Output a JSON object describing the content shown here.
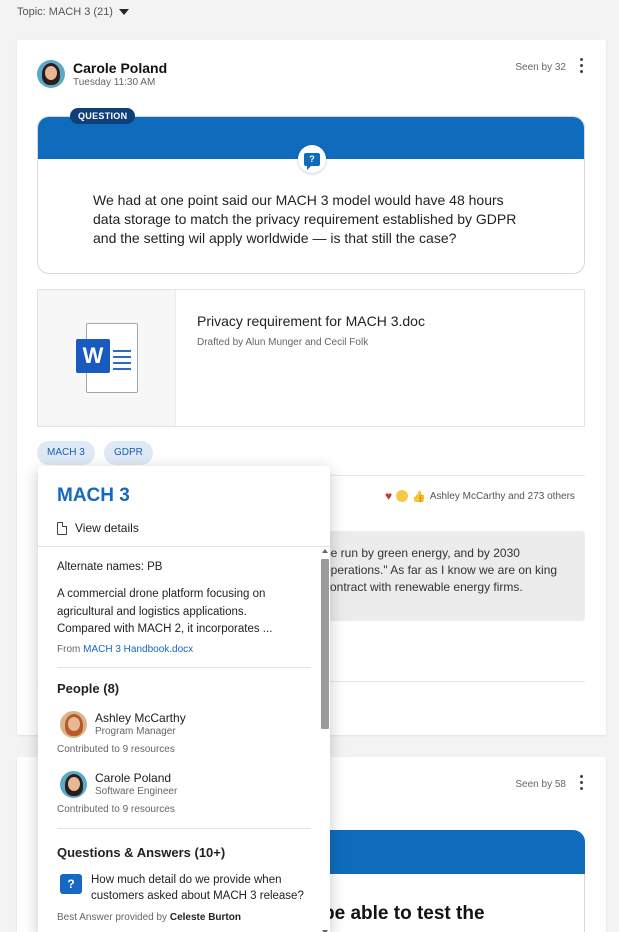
{
  "topic_filter": {
    "label": "Topic: MACH 3 (21)"
  },
  "post1": {
    "author": "Carole Poland",
    "time": "Tuesday 11:30 AM",
    "seen": "Seen by 32",
    "badge": "QUESTION",
    "question": "We had at one point said our MACH 3 model would have 48 hours data storage to match the privacy requirement established by GDPR and the setting wil apply worldwide — is that still the case?",
    "attachment": {
      "title": "Privacy requirement for MACH 3.doc",
      "subtitle": "Drafted by Alun Munger and Cecil Folk",
      "icon_letter": "W"
    },
    "tags": [
      "MACH 3",
      "GDPR"
    ],
    "reactions_text": "Ashley McCarthy and 273 others",
    "reply_excerpt": "be run by green energy, and by 2030 operations.\" As far as I know we are on king contract with renewable energy firms."
  },
  "post2": {
    "seen": "Seen by 58",
    "headline": "be able to test the"
  },
  "topic_card": {
    "title": "MACH 3",
    "view_details": "View details",
    "alternate_names": "Alternate names: PB",
    "description": "A commercial drone platform focusing on agricultural and logistics applications. Compared with MACH 2, it incorporates ...",
    "from_prefix": "From",
    "from_link": "MACH 3 Handbook.docx",
    "people_header": "People (8)",
    "people": [
      {
        "name": "Ashley McCarthy",
        "role": "Program Manager",
        "contrib": "Contributed to 9 resources"
      },
      {
        "name": "Carole Poland",
        "role": "Software Engineer",
        "contrib": "Contributed to 9 resources"
      }
    ],
    "qa_header": "Questions & Answers (10+)",
    "qa": {
      "question": "How much detail do we provide when customers asked about MACH 3 release?",
      "best_prefix": "Best Answer provided by",
      "best_name": "Celeste Burton"
    }
  },
  "colors": {
    "accent": "#0f6cbd",
    "link": "#1768c4",
    "tag_bg": "#dfe9f5"
  }
}
